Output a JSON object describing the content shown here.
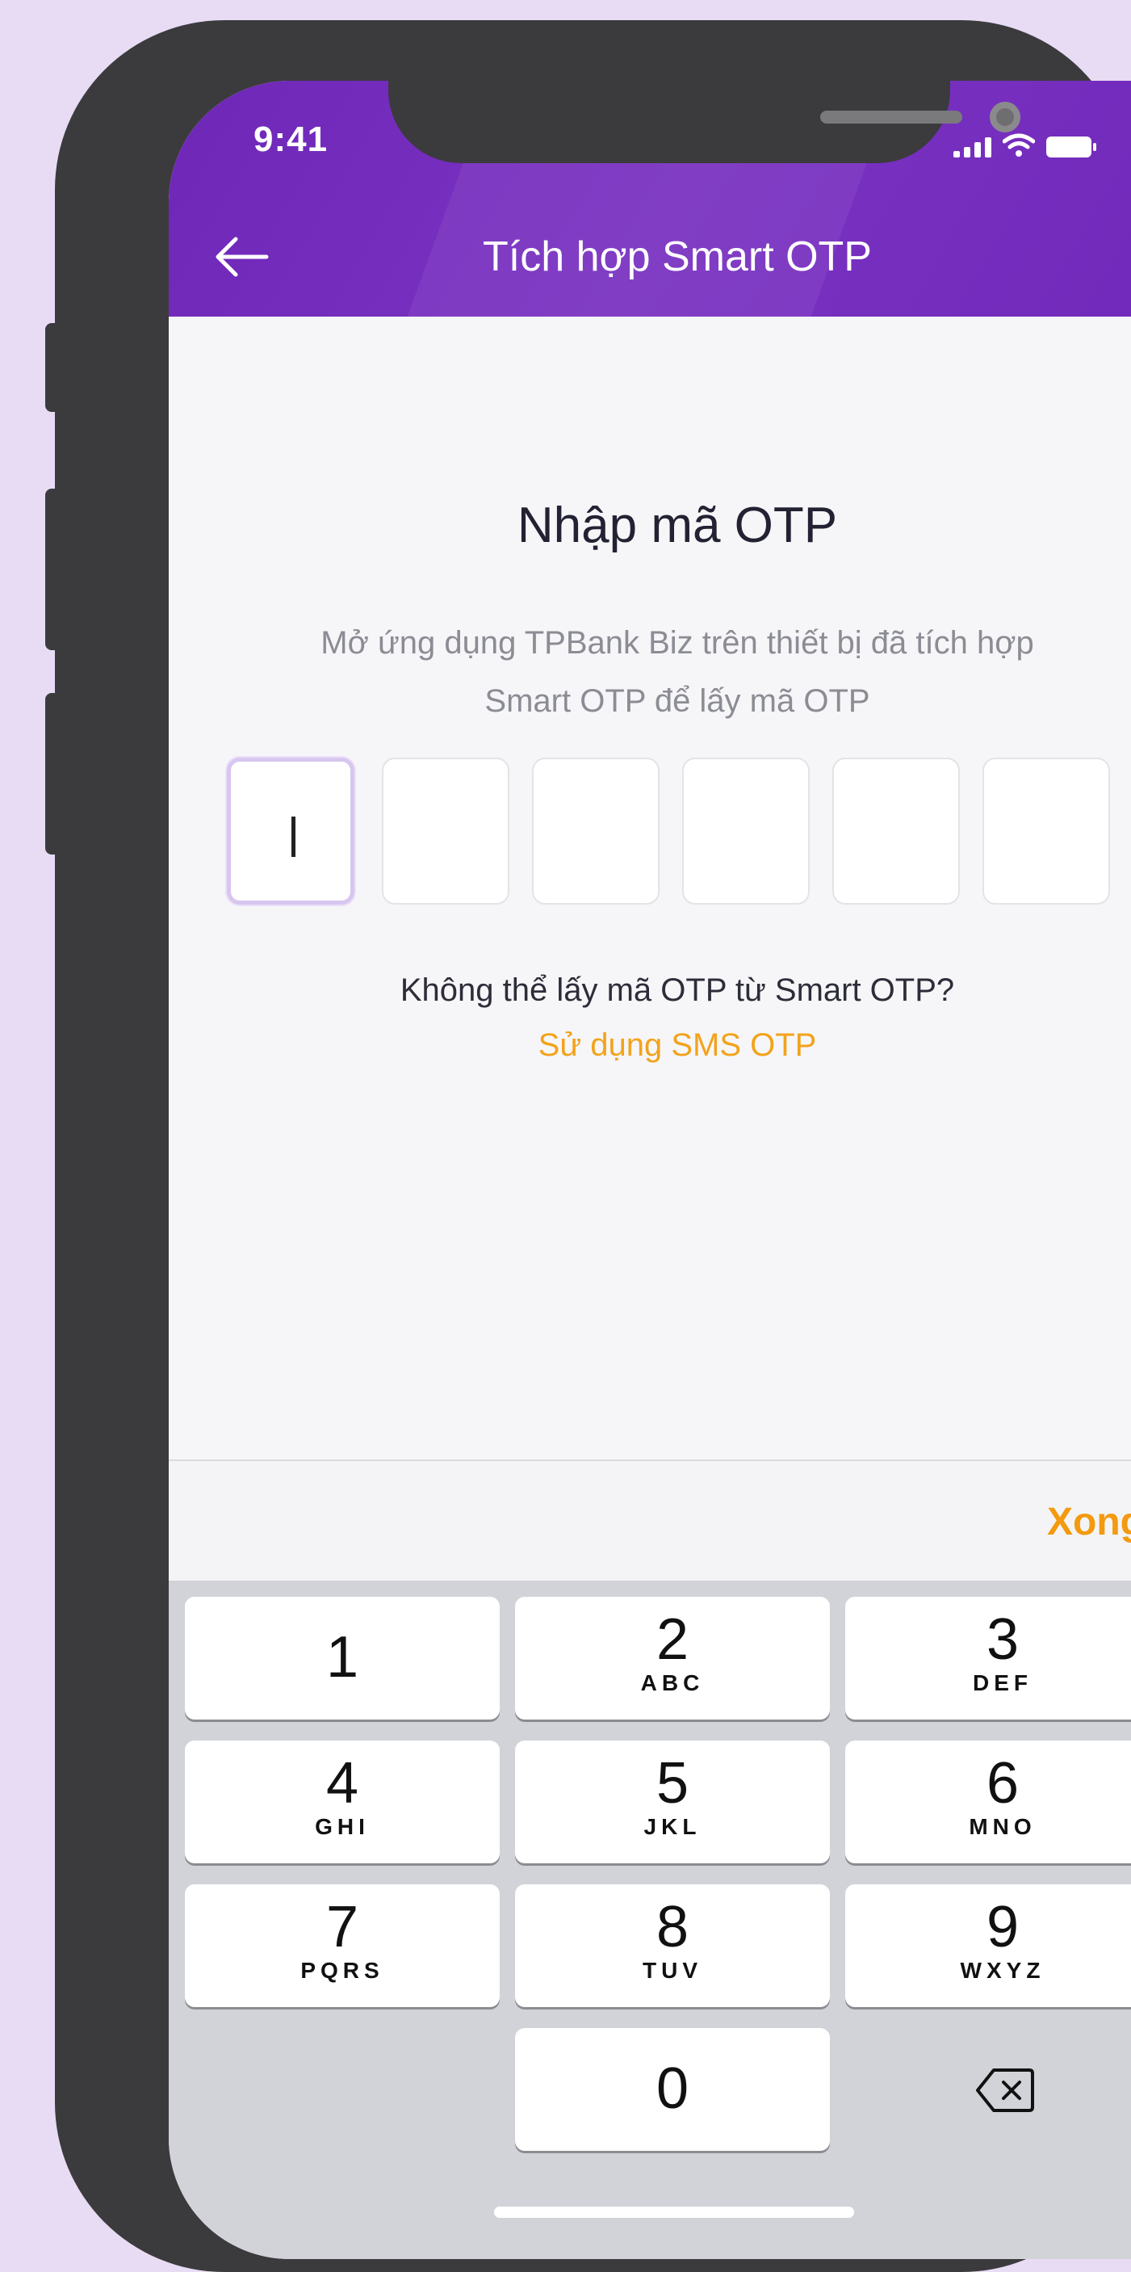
{
  "status_bar": {
    "time": "9:41"
  },
  "header": {
    "title": "Tích hợp Smart OTP"
  },
  "main": {
    "heading": "Nhập mã OTP",
    "description_line1": "Mở ứng dụng TPBank Biz trên thiết bị đã tích hợp",
    "description_line2": "Smart OTP để lấy mã OTP",
    "otp_boxes": [
      "",
      "",
      "",
      "",
      "",
      ""
    ],
    "help_text": "Không thể lấy mã OTP từ Smart OTP?",
    "sms_link": "Sử dụng SMS OTP"
  },
  "keyboard": {
    "done_label": "Xong",
    "keys": [
      {
        "num": "1",
        "letters": ""
      },
      {
        "num": "2",
        "letters": "ABC"
      },
      {
        "num": "3",
        "letters": "DEF"
      },
      {
        "num": "4",
        "letters": "GHI"
      },
      {
        "num": "5",
        "letters": "JKL"
      },
      {
        "num": "6",
        "letters": "MNO"
      },
      {
        "num": "7",
        "letters": "PQRS"
      },
      {
        "num": "8",
        "letters": "TUV"
      },
      {
        "num": "9",
        "letters": "WXYZ"
      },
      {
        "num": "0",
        "letters": ""
      }
    ]
  },
  "colors": {
    "header": "#7129bb",
    "accent": "#f39a0f",
    "background": "#e8dcf5"
  }
}
